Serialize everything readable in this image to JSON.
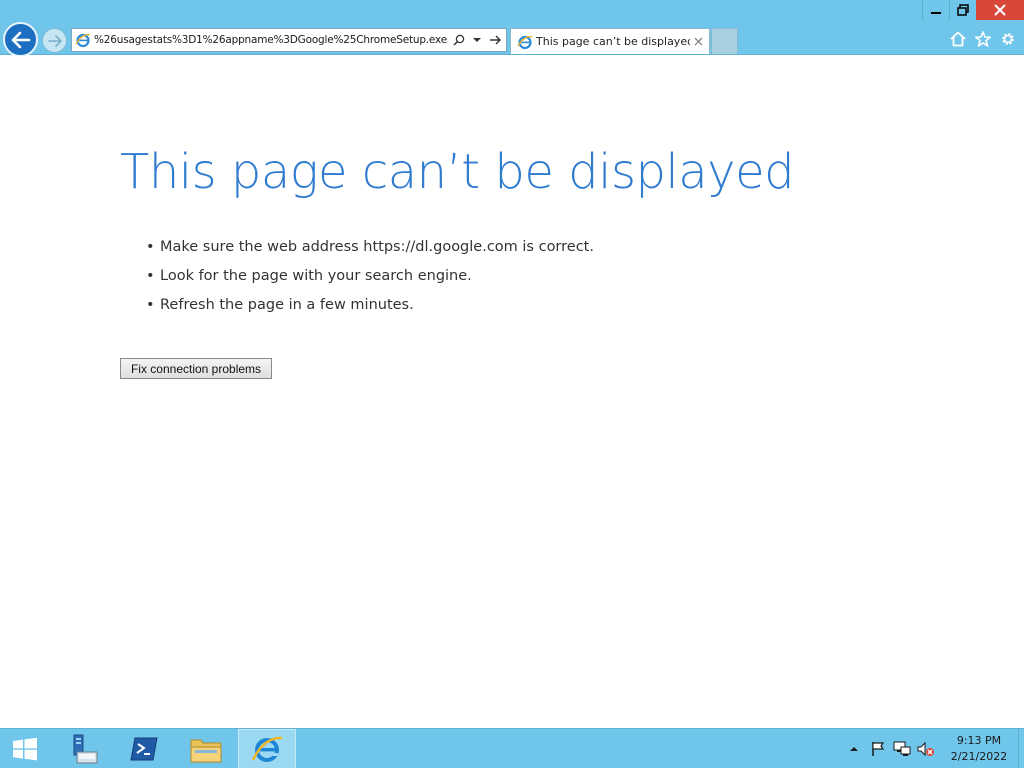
{
  "window": {
    "minimize_icon": "minimize-icon",
    "restore_icon": "restore-icon",
    "close_icon": "close-icon"
  },
  "toolbar": {
    "back_icon": "back-arrow-icon",
    "forward_icon": "forward-arrow-icon",
    "address": {
      "value": "%26usagestats%3D1%26appname%3DGoogle%25ChromeSetup.exe",
      "search_icon": "search-icon",
      "dropdown_icon": "chevron-down-icon",
      "go_icon": "go-arrow-icon"
    },
    "tab": {
      "title": "This page can’t be displayed",
      "close_glyph": "×"
    },
    "right_icons": [
      "home-icon",
      "favorites-star-icon",
      "gear-icon"
    ]
  },
  "content": {
    "title": "This page can’t be displayed",
    "bullet_glyph": "•",
    "suggestions": [
      "Make sure the web address https://dl.google.com is correct.",
      "Look for the page with your search engine.",
      "Refresh the page in a few minutes."
    ],
    "fix_button_label": "Fix connection problems"
  },
  "taskbar": {
    "apps": [
      "start-windows-icon",
      "server-manager-icon",
      "powershell-icon",
      "file-explorer-icon",
      "internet-explorer-icon"
    ],
    "tray_icons": [
      "show-hidden-icons-chevron-icon",
      "action-center-flag-icon",
      "network-icon",
      "speaker-muted-icon"
    ],
    "clock": {
      "time": "9:13 PM",
      "date": "2/21/2022"
    }
  },
  "colors": {
    "chrome_bg": "#6fc6ea",
    "title_blue": "#2f7bd0",
    "close_red": "#d9473b",
    "back_button": "#1c6fc0"
  }
}
